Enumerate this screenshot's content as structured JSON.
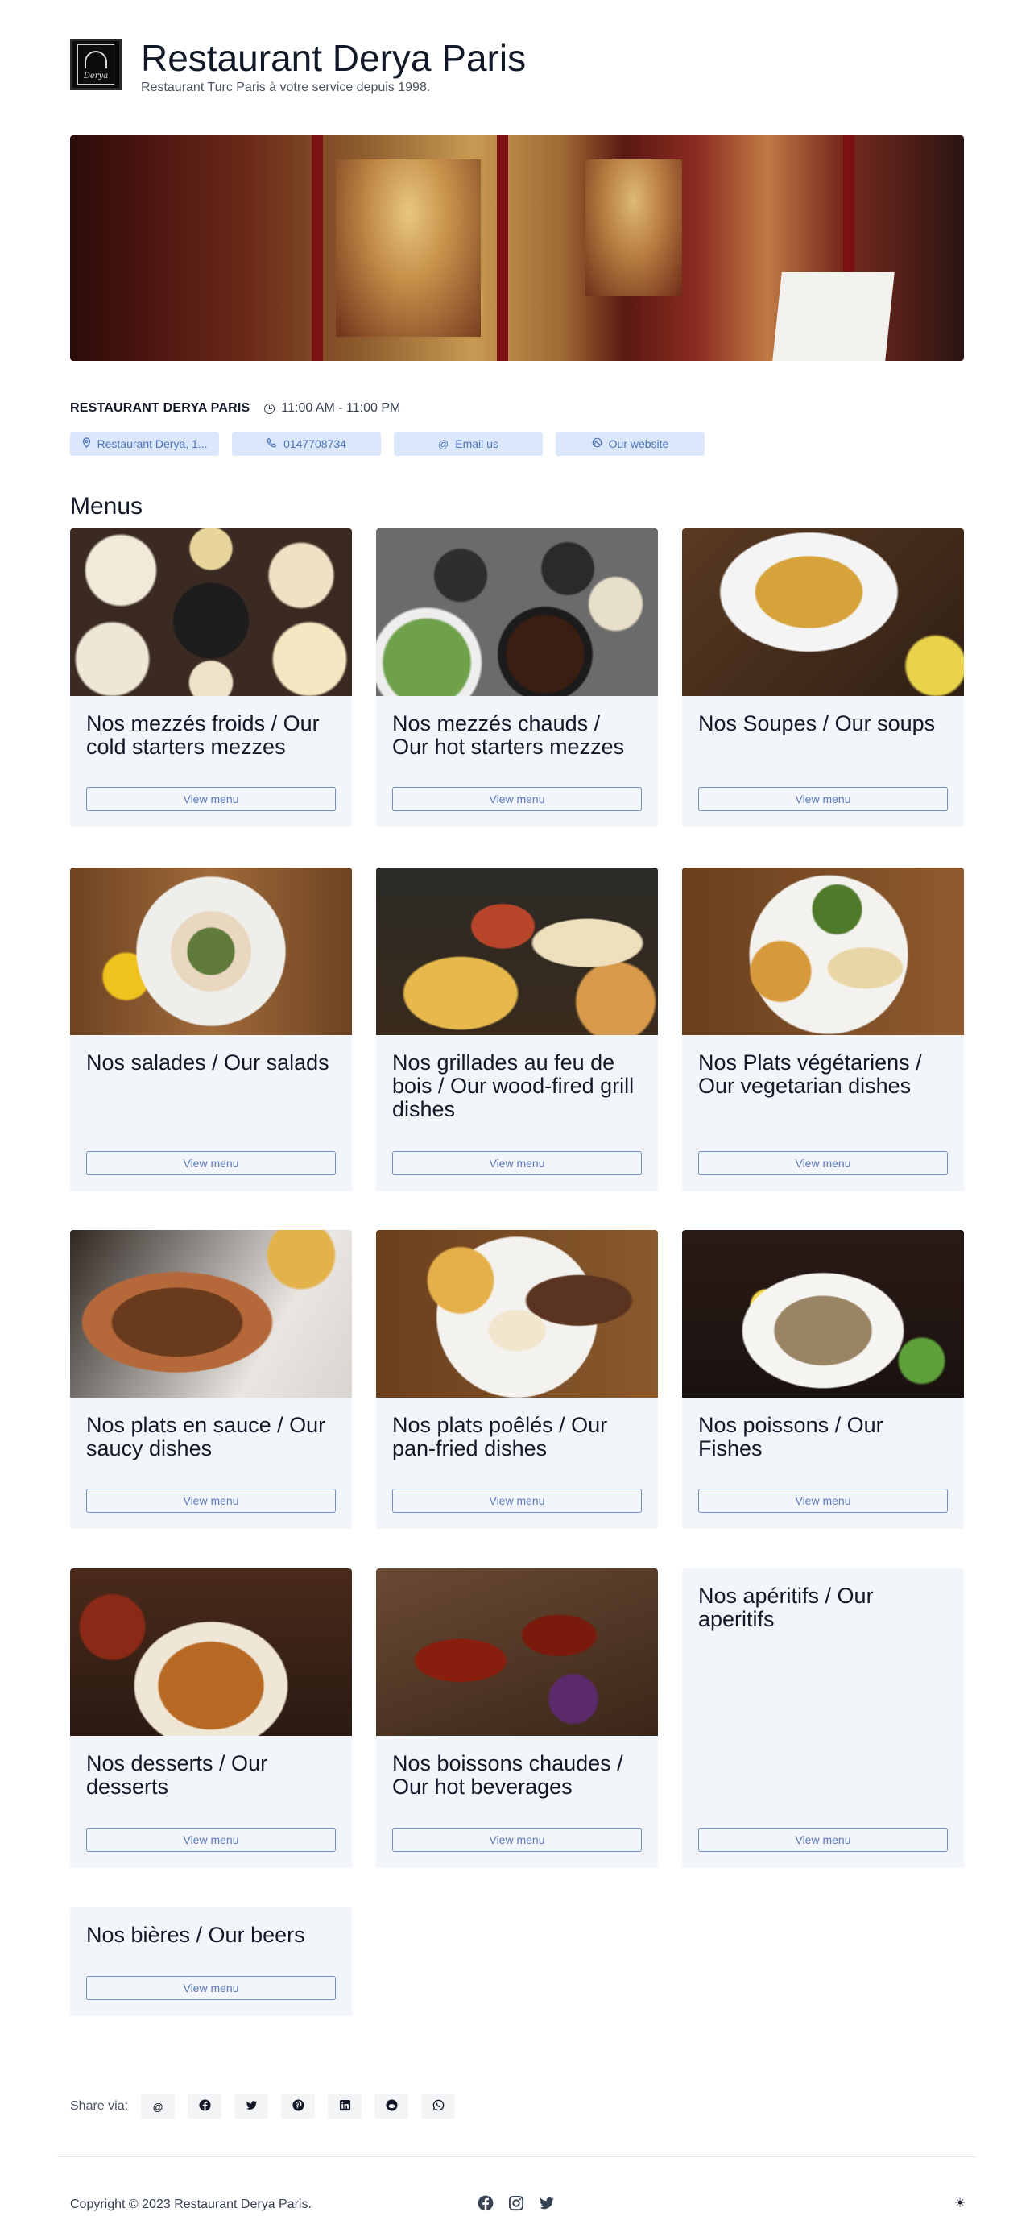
{
  "header": {
    "logo_alt": "Derya",
    "title": "Restaurant Derya Paris",
    "subtitle": "Restaurant Turc Paris à votre service depuis 1998."
  },
  "info": {
    "name": "RESTAURANT DERYA PARIS",
    "hours": "11:00 AM - 11:00 PM",
    "chips": {
      "address": "Restaurant Derya, 1...",
      "phone": "0147708734",
      "email": "Email us",
      "website": "Our website"
    },
    "icons": {
      "address": "map-pin-icon",
      "phone": "phone-icon",
      "email": "at-icon",
      "website": "globe-icon",
      "hours": "clock-icon"
    }
  },
  "menus": {
    "heading": "Menus",
    "button_label": "View menu",
    "items": [
      {
        "title": "Nos mezzés froids / Our cold starters mezzes"
      },
      {
        "title": "Nos mezzés chauds / Our hot starters mezzes"
      },
      {
        "title": "Nos Soupes / Our soups"
      },
      {
        "title": "Nos salades / Our salads"
      },
      {
        "title": "Nos grillades au feu de bois / Our wood-fired grill dishes"
      },
      {
        "title": "Nos Plats végétariens / Our vegetarian dishes"
      },
      {
        "title": "Nos plats en sauce / Our saucy dishes"
      },
      {
        "title": "Nos plats poêlés / Our pan-fried dishes"
      },
      {
        "title": "Nos poissons / Our Fishes"
      },
      {
        "title": "Nos desserts / Our desserts"
      },
      {
        "title": "Nos boissons chaudes / Our hot beverages"
      },
      {
        "title": "Nos apéritifs / Our aperitifs"
      },
      {
        "title": "Nos bières / Our beers"
      }
    ]
  },
  "share": {
    "label": "Share via:",
    "targets": [
      "email-icon",
      "facebook-icon",
      "twitter-icon",
      "pinterest-icon",
      "linkedin-icon",
      "reddit-icon",
      "whatsapp-icon"
    ]
  },
  "footer": {
    "copyright": "Copyright © 2023 Restaurant Derya Paris.",
    "social": [
      "facebook-icon",
      "instagram-icon",
      "twitter-icon"
    ],
    "theme_icon": "sun-icon"
  },
  "colors": {
    "chip_bg": "#dbe8fb",
    "chip_text": "#4f74b8",
    "card_bg": "#f2f5f9",
    "button_border": "#6f8fc8"
  }
}
